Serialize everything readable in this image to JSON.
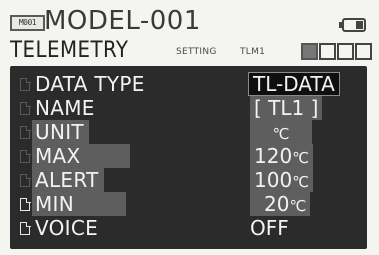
{
  "header": {
    "model_tag": "M001",
    "model_name": "MODEL-001"
  },
  "tabs": {
    "telemetry": "TELEMETRY",
    "setting": "SETTING",
    "tlm": "TLM1"
  },
  "pages": [
    "page-1",
    "page-2",
    "page-3",
    "page-4"
  ],
  "rows": [
    {
      "label": "DATA TYPE",
      "value": "TL-DATA"
    },
    {
      "label": "NAME",
      "value": "[ TL1 ]"
    },
    {
      "label": "UNIT",
      "value": "℃"
    },
    {
      "label": "MAX",
      "value": "120",
      "unit": "℃"
    },
    {
      "label": "ALERT",
      "value": "100",
      "unit": "℃"
    },
    {
      "label": "MIN",
      "value": "20",
      "unit": "℃"
    },
    {
      "label": "VOICE",
      "value": "OFF"
    }
  ],
  "colors": {
    "panel": "#2b2b2b",
    "highlight": "#5e5e5e",
    "selected": "#0f0f0f",
    "text": "#f2f2f2",
    "header_text": "#3a3a3a"
  },
  "icons": [
    "battery-icon",
    "document-icon"
  ]
}
